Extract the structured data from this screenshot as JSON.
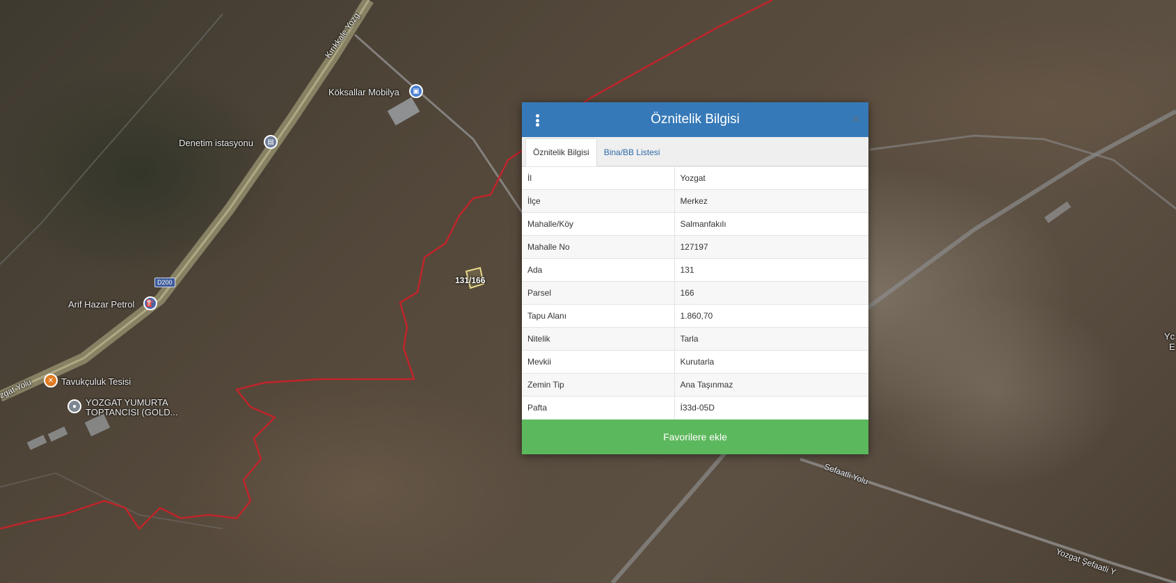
{
  "map": {
    "pois": [
      {
        "label": "Köksallar Mobilya",
        "icon": "shopping-bag-icon",
        "color": "#4a7fd0"
      },
      {
        "label": "Denetim istasyonu",
        "icon": "building-icon",
        "color": "#6d7b9a"
      },
      {
        "label": "Arif Hazar Petrol",
        "icon": "fuel-icon",
        "color": "#4a66b0"
      },
      {
        "label": "Tavukçuluk Tesisi",
        "icon": "restaurant-icon",
        "color": "#e07b22"
      },
      {
        "label": "YOZGAT YUMURTA",
        "label2": "TOPTANCISI (GOLD...",
        "icon": "location-icon",
        "color": "#7d8792"
      }
    ],
    "roads": {
      "highway_top": "Kırıkkale Yozg",
      "highway_left": "zgat Yolu",
      "shield": "D200",
      "road_right_1": "Sefaatli Yolu",
      "road_right_2": "Yozgat Şefaatli Y"
    },
    "edge_label_1": "Yc",
    "edge_label_2": "E",
    "parcel_label": "131/166",
    "boundary_color": "#c0242a"
  },
  "dialog": {
    "title": "Öznitelik Bilgisi",
    "close": "×",
    "tabs": [
      {
        "label": "Öznitelik Bilgisi",
        "active": true
      },
      {
        "label": "Bina/BB Listesi",
        "active": false
      }
    ],
    "rows": [
      {
        "key": "İl",
        "value": "Yozgat"
      },
      {
        "key": "İlçe",
        "value": "Merkez"
      },
      {
        "key": "Mahalle/Köy",
        "value": "Salmanfakılı"
      },
      {
        "key": "Mahalle No",
        "value": "127197"
      },
      {
        "key": "Ada",
        "value": "131"
      },
      {
        "key": "Parsel",
        "value": "166"
      },
      {
        "key": "Tapu Alanı",
        "value": "1.860,70"
      },
      {
        "key": "Nitelik",
        "value": "Tarla"
      },
      {
        "key": "Mevkii",
        "value": "Kurutarla"
      },
      {
        "key": "Zemin Tip",
        "value": "Ana Taşınmaz"
      },
      {
        "key": "Pafta",
        "value": "İ33d-05D"
      }
    ],
    "favorite_button": "Favorilere ekle",
    "header_color": "#3679b8",
    "button_color": "#5cb85c"
  }
}
